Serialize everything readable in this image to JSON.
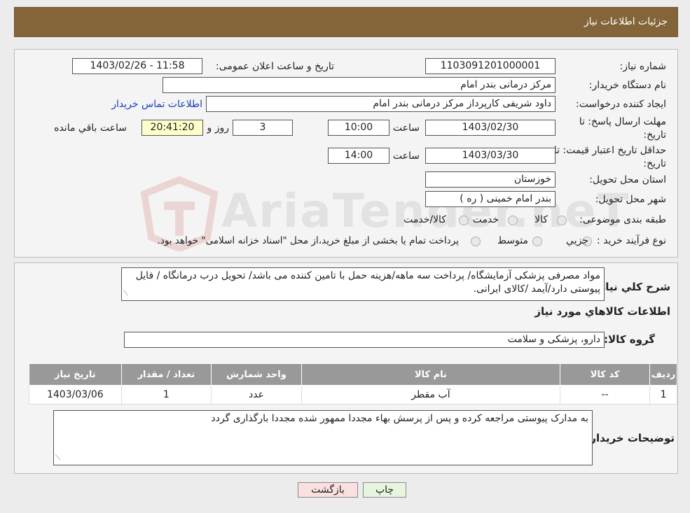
{
  "header": {
    "title": "جزئیات اطلاعات نیاز"
  },
  "form": {
    "need_number_label": "شماره نیاز:",
    "need_number": "1103091201000001",
    "announce_label": "تاریخ و ساعت اعلان عمومی:",
    "announce_value": "1403/02/26 - 11:58",
    "buyer_org_label": "نام دستگاه خریدار:",
    "buyer_org": "مرکز درمانی بندر امام",
    "requester_label": "ایجاد کننده درخواست:",
    "requester": "داود شریفی کارپرداز مرکز درمانی بندر امام",
    "contact_link": "اطلاعات تماس خریدار",
    "deadline_label_1": "مهلت ارسال پاسخ: تا",
    "deadline_label_2": "تاریخ:",
    "deadline_date": "1403/02/30",
    "time_label": "ساعت",
    "deadline_time": "10:00",
    "days": "3",
    "days_label": "روز و",
    "remaining": "20:41:20",
    "remaining_label": "ساعت باقي مانده",
    "validity_label_1": "حداقل تاریخ اعتبار قیمت: تا",
    "validity_label_2": "تاریخ:",
    "validity_date": "1403/03/30",
    "validity_time": "14:00",
    "province_label": "استان محل تحویل:",
    "province": "خوزستان",
    "city_label": "شهر محل تحویل:",
    "city": "بندر امام خمینی ( ره )",
    "category_label": "طبقه بندی موضوعی:",
    "category_options": [
      "کالا",
      "خدمت",
      "کالا/خدمت"
    ],
    "process_label": "نوع فرآیند خرید :",
    "process_options": [
      "جزیي",
      "متوسط"
    ],
    "process_note": "پرداخت تمام یا بخشی از مبلغ خرید،از محل \"اسناد خزانه اسلامی\" خواهد بود."
  },
  "description": {
    "label": "شرح کلي نیاز:",
    "text": "مواد مصرفی پزشکی آزمایشگاه/ پرداخت سه ماهه/هزینه حمل با تامین کننده می باشد/ تحویل درب درمانگاه / فایل پیوستی دارد/آیمد /کالای ایرانی."
  },
  "goods": {
    "section_title": "اطلاعات کالاهاي مورد نیاز",
    "group_label": "گروه کالا:",
    "group_value": "دارو، پزشکی و سلامت",
    "columns": [
      "ردیف",
      "کد کالا",
      "نام کالا",
      "واحد شمارش",
      "تعداد / مقدار",
      "تاریخ نیاز"
    ],
    "rows": [
      [
        "1",
        "--",
        "آب مقطر",
        "عدد",
        "1",
        "1403/03/06"
      ]
    ]
  },
  "buyer_notes": {
    "label": "توضیحات خریدار:",
    "text": "به مدارک پیوستی مراجعه کرده و پس از پرسش بهاء مجددا ممهور شده مجددا بارگذاری گردد"
  },
  "buttons": {
    "print": "چاپ",
    "back": "بازگشت"
  },
  "watermark": {
    "text": "AriaTender.neT"
  },
  "colors": {
    "header": "#84653a",
    "print_btn": "#e6f5de",
    "back_btn": "#fbe0e0",
    "link": "#1a3fbf"
  }
}
